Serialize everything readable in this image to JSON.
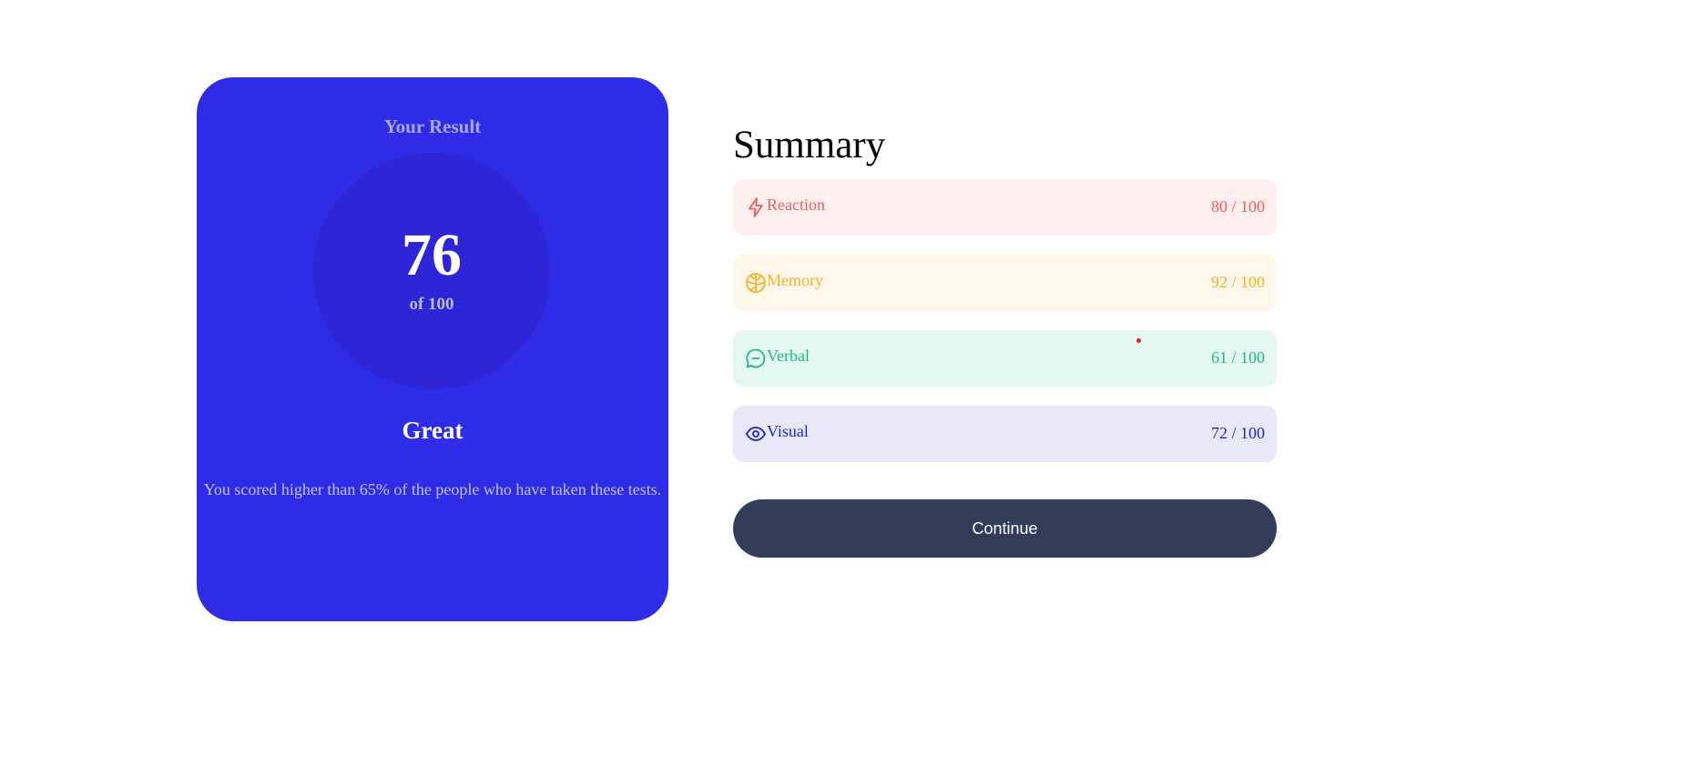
{
  "result": {
    "heading": "Your Result",
    "score": "76",
    "out_of": "of 100",
    "rating": "Great",
    "description": "You scored higher than 65% of the people who have taken these tests.",
    "card_color": "#2f2ce8"
  },
  "summary": {
    "title": "Summary",
    "items": [
      {
        "label": "Reaction",
        "score": "80",
        "max": "100",
        "score_text": "80 / 100",
        "icon": "lightning-icon",
        "text_color": "#f25c5c",
        "bg_color": "#ffefef"
      },
      {
        "label": "Memory",
        "score": "92",
        "max": "100",
        "score_text": "92 / 100",
        "icon": "brain-icon",
        "text_color": "#f2b328",
        "bg_color": "#fff7ea"
      },
      {
        "label": "Verbal",
        "score": "61",
        "max": "100",
        "score_text": "61 / 100",
        "icon": "chat-bubble-icon",
        "text_color": "#1db886",
        "bg_color": "#e5f7f2"
      },
      {
        "label": "Visual",
        "score": "72",
        "max": "100",
        "score_text": "72 / 100",
        "icon": "eye-icon",
        "text_color": "#1c27c6",
        "bg_color": "#e8e8f9"
      }
    ]
  },
  "continue_label": "Continue",
  "button_color": "#313d59"
}
